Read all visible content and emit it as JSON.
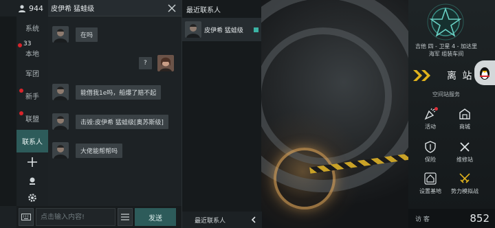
{
  "colors": {
    "accent": "#2d5b5a",
    "badge_red": "#d8242b",
    "online": "#3bb3a4",
    "chevron": "#e0b21c"
  },
  "top_stat": {
    "icon": "person-icon",
    "value": "944"
  },
  "sidebar": {
    "items": [
      {
        "label": "系统",
        "badge": ""
      },
      {
        "label": "本地",
        "badge": "33"
      },
      {
        "label": "军团",
        "badge": ""
      },
      {
        "label": "新手",
        "badge": "dot"
      },
      {
        "label": "联盟",
        "badge": "dot"
      },
      {
        "label": "联系人",
        "badge": "",
        "active": true
      }
    ],
    "add_icon": "plus-icon",
    "pin_icon": "pin-icon",
    "settings_icon": "gear-icon"
  },
  "chat": {
    "title": "皮伊希 猛蛙级",
    "messages": [
      {
        "side": "left",
        "text": "在吗"
      },
      {
        "side": "right",
        "text": "?"
      },
      {
        "side": "left",
        "text": "能借我1e吗，船爆了赔不起"
      },
      {
        "side": "left",
        "text": "击毁:皮伊希 猛蛙级[奥苏斯级]"
      },
      {
        "side": "left",
        "text": "大佬能帮帮吗"
      }
    ],
    "input_placeholder": "点击输入内容!",
    "send_label": "发送"
  },
  "contacts": {
    "header": "最近联系人",
    "list": [
      {
        "name": "皮伊希 猛蛙级",
        "online": true
      }
    ],
    "footer_label": "最近联系人"
  },
  "station": {
    "location_line1": "吉他 四 - 卫星 4 - 加达里",
    "location_line2": "海军 组装车间",
    "undock_label": "离 站",
    "service_title": "空间站服务",
    "services": [
      {
        "label": "活动",
        "icon": "party-icon",
        "badge": true
      },
      {
        "label": "商城",
        "icon": "shop-icon",
        "badge": false
      },
      {
        "label": "保险",
        "icon": "shield-icon",
        "badge": false
      },
      {
        "label": "维修站",
        "icon": "wrench-icon",
        "badge": false
      },
      {
        "label": "设置基地",
        "icon": "home-icon",
        "badge": false
      },
      {
        "label": "势力模拟战",
        "icon": "crossed-swords-icon",
        "badge": false
      }
    ],
    "visitor_label": "访 客",
    "visitor_count": "852"
  }
}
